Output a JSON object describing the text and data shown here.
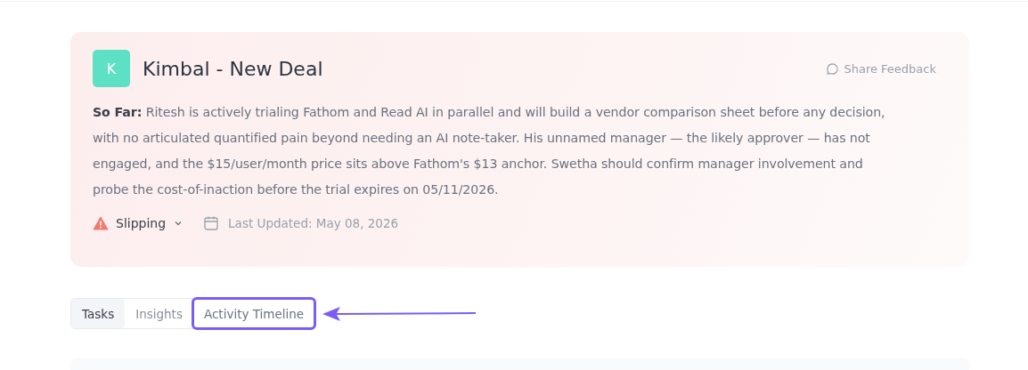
{
  "deal": {
    "avatar": "K",
    "title": "Kimbal - New Deal",
    "share": "Share Feedback",
    "summary": "**So Far:** Ritesh is actively trialing Fathom and Read AI in parallel and will build a vendor comparison sheet before any decision, with no articulated quantified pain beyond needing an AI note-taker. His unnamed manager — the likely approver — has not engaged, and the $15/user/month price sits above Fathom's $13 anchor. Swetha should confirm manager involvement and probe the cost-of-inaction before the trial expires on 05/11/2026.",
    "status": "Slipping",
    "updated": "Last Updated: May 08, 2026"
  },
  "tabs": [
    {
      "label": "Tasks",
      "selected": true,
      "highlighted": false
    },
    {
      "label": "Insights",
      "selected": false,
      "highlighted": false
    },
    {
      "label": "Activity Timeline",
      "selected": false,
      "highlighted": true
    }
  ]
}
